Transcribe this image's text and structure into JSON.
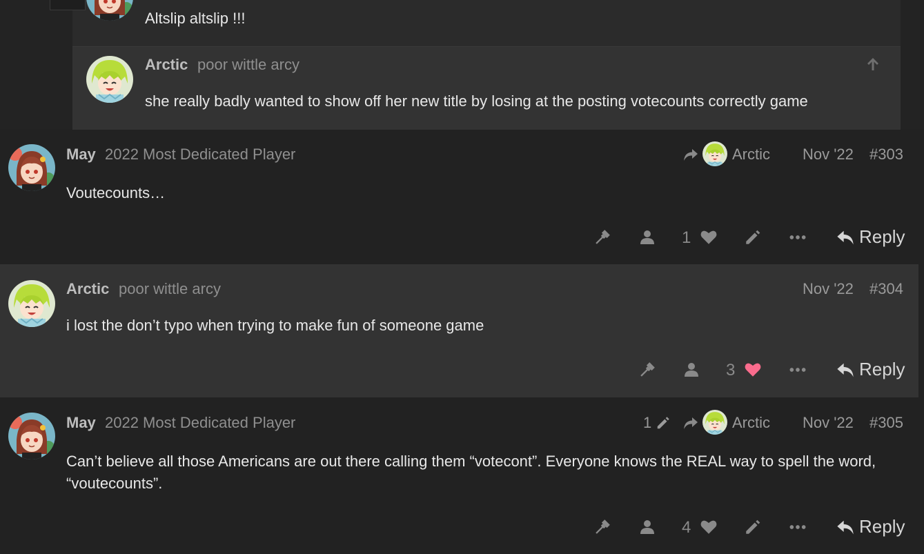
{
  "embedded": {
    "parent_text": "Altslip altslip !!!",
    "reply": {
      "username": "Arctic",
      "user_title": "poor wittle arcy",
      "text": "she really badly wanted to show off her new title by losing at the posting votecounts correctly game",
      "icon": "arrow-up-icon"
    }
  },
  "posts": [
    {
      "username": "May",
      "user_title": "2022 Most Dedicated Player",
      "reply_to": "Arctic",
      "date": "Nov '22",
      "number": "#303",
      "text": "Voutecounts…",
      "likes": "1",
      "liked": false,
      "reply_label": "Reply"
    },
    {
      "username": "Arctic",
      "user_title": "poor wittle arcy",
      "date": "Nov '22",
      "number": "#304",
      "text": "i lost the don’t typo when trying to make fun of someone game",
      "likes": "3",
      "liked": true,
      "reply_label": "Reply"
    },
    {
      "username": "May",
      "user_title": "2022 Most Dedicated Player",
      "edits": "1",
      "reply_to": "Arctic",
      "date": "Nov '22",
      "number": "#305",
      "text": "Can’t believe all those Americans are out there calling them “votecont”. Everyone knows the REAL way to spell the word, “voutecounts”.",
      "likes": "4",
      "liked": false,
      "reply_label": "Reply"
    }
  ],
  "colors": {
    "background": "#222222",
    "alt_post_bg": "#333333",
    "liked_heart": "#fa6c8d",
    "icon_gray": "#8a8a8a"
  }
}
